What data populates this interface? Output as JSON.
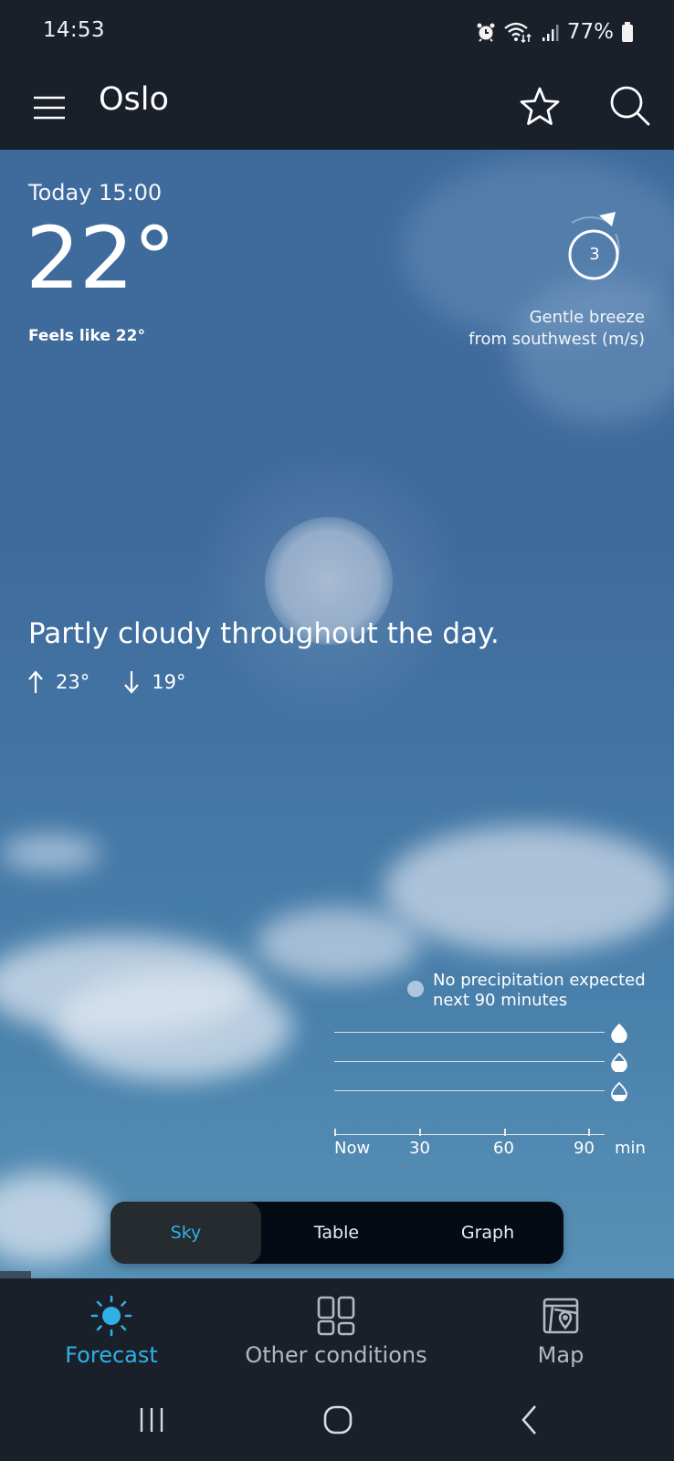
{
  "status_bar": {
    "time": "14:53",
    "battery": "77%",
    "icons": [
      "alarm-icon",
      "wifi-icon",
      "signal-icon",
      "battery-icon"
    ]
  },
  "app_bar": {
    "city": "Oslo",
    "icons": [
      "menu-icon",
      "star-icon",
      "search-icon"
    ]
  },
  "current": {
    "date_time": "Today 15:00",
    "temperature": "22°",
    "feels_like": "Feels like  22°",
    "wind": {
      "speed": "3",
      "description_line1": "Gentle breeze",
      "description_line2": "from southwest (m/s)",
      "direction": "southwest"
    },
    "summary": "Partly cloudy throughout the day.",
    "high": "23°",
    "low": "19°"
  },
  "precipitation": {
    "message_line1": "No precipitation expected",
    "message_line2": "next 90 minutes",
    "intensity_levels": [
      "heavy",
      "moderate",
      "light"
    ],
    "axis_ticks": [
      "Now",
      "30",
      "60",
      "90"
    ],
    "axis_unit": "min",
    "values": []
  },
  "view_switcher": {
    "options": [
      "Sky",
      "Table",
      "Graph"
    ],
    "selected": "Sky"
  },
  "bottom_nav": {
    "items": [
      {
        "label": "Forecast",
        "icon": "sun-icon",
        "active": true
      },
      {
        "label": "Other conditions",
        "icon": "grid-icon",
        "active": false
      },
      {
        "label": "Map",
        "icon": "map-icon",
        "active": false
      }
    ]
  },
  "colors": {
    "accent": "#2fb1e6",
    "bar_bg": "#1a202a",
    "sky_top": "#3f6b9c",
    "sky_bottom": "#5891b7"
  }
}
